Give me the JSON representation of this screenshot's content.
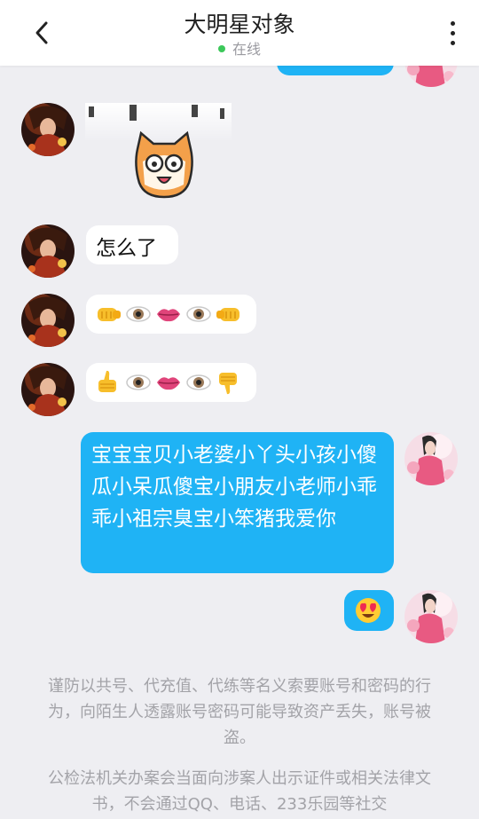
{
  "header": {
    "title": "大明星对象",
    "status": "在线"
  },
  "icons": {
    "back": "chevron-left-icon",
    "more": "more-vertical-icon",
    "emoji_fist_right": "fist-right-emoji",
    "emoji_eye": "eye-emoji",
    "emoji_lips": "lips-emoji",
    "emoji_fist_left": "fist-left-emoji",
    "emoji_thumbs_up": "thumbs-up-emoji",
    "emoji_thumbs_down": "thumbs-down-emoji",
    "emoji_heart_eyes": "heart-eyes-emoji"
  },
  "messages": [
    {
      "side": "left",
      "type": "sticker",
      "sticker": "cartoon-face-sticker"
    },
    {
      "side": "left",
      "type": "text",
      "text": "怎么了"
    },
    {
      "side": "left",
      "type": "emoji",
      "emojis": [
        "fist-right",
        "eye",
        "lips",
        "eye",
        "fist-left"
      ]
    },
    {
      "side": "left",
      "type": "emoji",
      "emojis": [
        "thumbs-up",
        "eye",
        "lips",
        "eye",
        "thumbs-down"
      ]
    },
    {
      "side": "right",
      "type": "text",
      "text": "宝宝宝贝小老婆小丫头小孩小傻瓜小呆瓜傻宝小朋友小老师小乖乖小祖宗臭宝小笨猪我爱你"
    },
    {
      "side": "right",
      "type": "emoji",
      "emojis": [
        "heart-eyes"
      ]
    }
  ],
  "notice": {
    "p1": "谨防以共号、代充值、代练等名义索要账号和密码的行为，向陌生人透露账号密码可能导致资产丢失，账号被盗。",
    "p2": "公检法机关办案会当面向涉案人出示证件或相关法律文书，不会通过QQ、电话、233乐园等社交"
  },
  "colors": {
    "accent": "#1fb3f5",
    "online": "#3cc85a",
    "background": "#eeeef2"
  }
}
